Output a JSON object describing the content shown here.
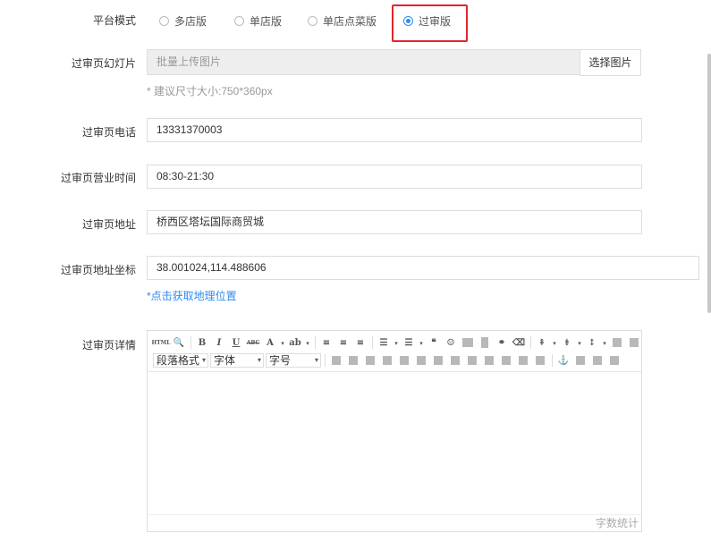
{
  "platform_mode": {
    "label": "平台模式",
    "options": [
      {
        "label": "多店版",
        "checked": false
      },
      {
        "label": "单店版",
        "checked": false
      },
      {
        "label": "单店点菜版",
        "checked": false
      },
      {
        "label": "过审版",
        "checked": true
      }
    ]
  },
  "slideshow": {
    "label": "过审页幻灯片",
    "placeholder": "批量上传图片",
    "button": "选择图片",
    "hint": "* 建议尺寸大小:750*360px"
  },
  "phone": {
    "label": "过审页电话",
    "value": "13331370003"
  },
  "hours": {
    "label": "过审页营业时间",
    "value": "08:30-21:30"
  },
  "address": {
    "label": "过审页地址",
    "value": "桥西区塔坛国际商贸城"
  },
  "coords": {
    "label": "过审页地址坐标",
    "value": "38.001024,114.488606",
    "link": "*点击获取地理位置"
  },
  "details": {
    "label": "过审页详情",
    "toolbar": {
      "paragraph": "段落格式",
      "font": "字体",
      "size": "字号",
      "bold": "B",
      "italic": "I",
      "underline": "U",
      "strike": "ABC",
      "fontcolor": "A",
      "html": "HTML"
    },
    "wordcount": "字数统计"
  },
  "colors": {
    "accent": "#2d8cf0",
    "highlight": "#e0262b"
  }
}
